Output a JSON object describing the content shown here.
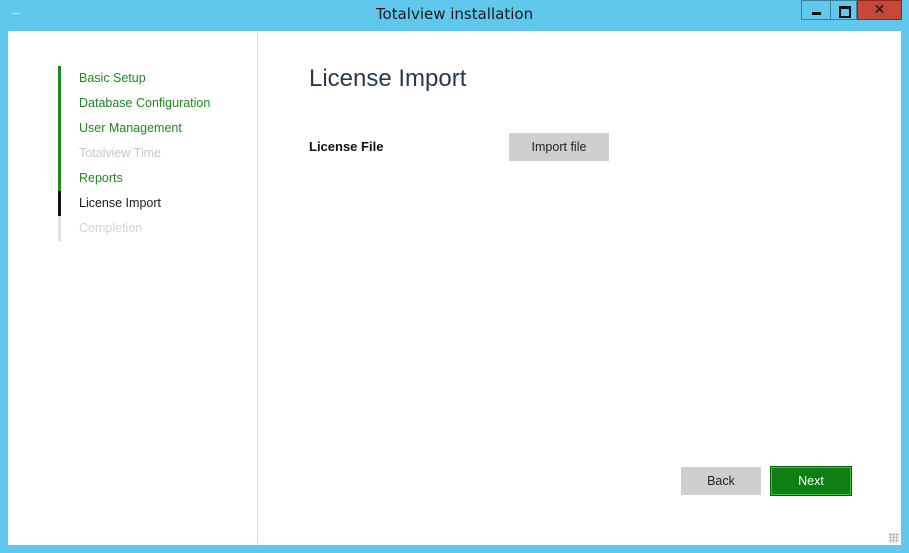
{
  "window": {
    "title": "Totalview installation",
    "app_icon": "~··",
    "close_glyph": "✕"
  },
  "sidebar": {
    "items": [
      {
        "label": "Basic Setup",
        "state": "done"
      },
      {
        "label": "Database Configuration",
        "state": "done"
      },
      {
        "label": "User Management",
        "state": "done"
      },
      {
        "label": "Totalview Time",
        "state": "disabled"
      },
      {
        "label": "Reports",
        "state": "done"
      },
      {
        "label": "License Import",
        "state": "current"
      },
      {
        "label": "Completion",
        "state": "todo"
      }
    ]
  },
  "main": {
    "heading": "License Import",
    "license_file_label": "License File",
    "import_button": "Import file"
  },
  "footer": {
    "back_label": "Back",
    "next_label": "Next"
  },
  "colors": {
    "frame": "#5fc8ec",
    "step_done": "#1e8a1e",
    "next_button": "#0e7f12",
    "close_button": "#c7483a"
  }
}
